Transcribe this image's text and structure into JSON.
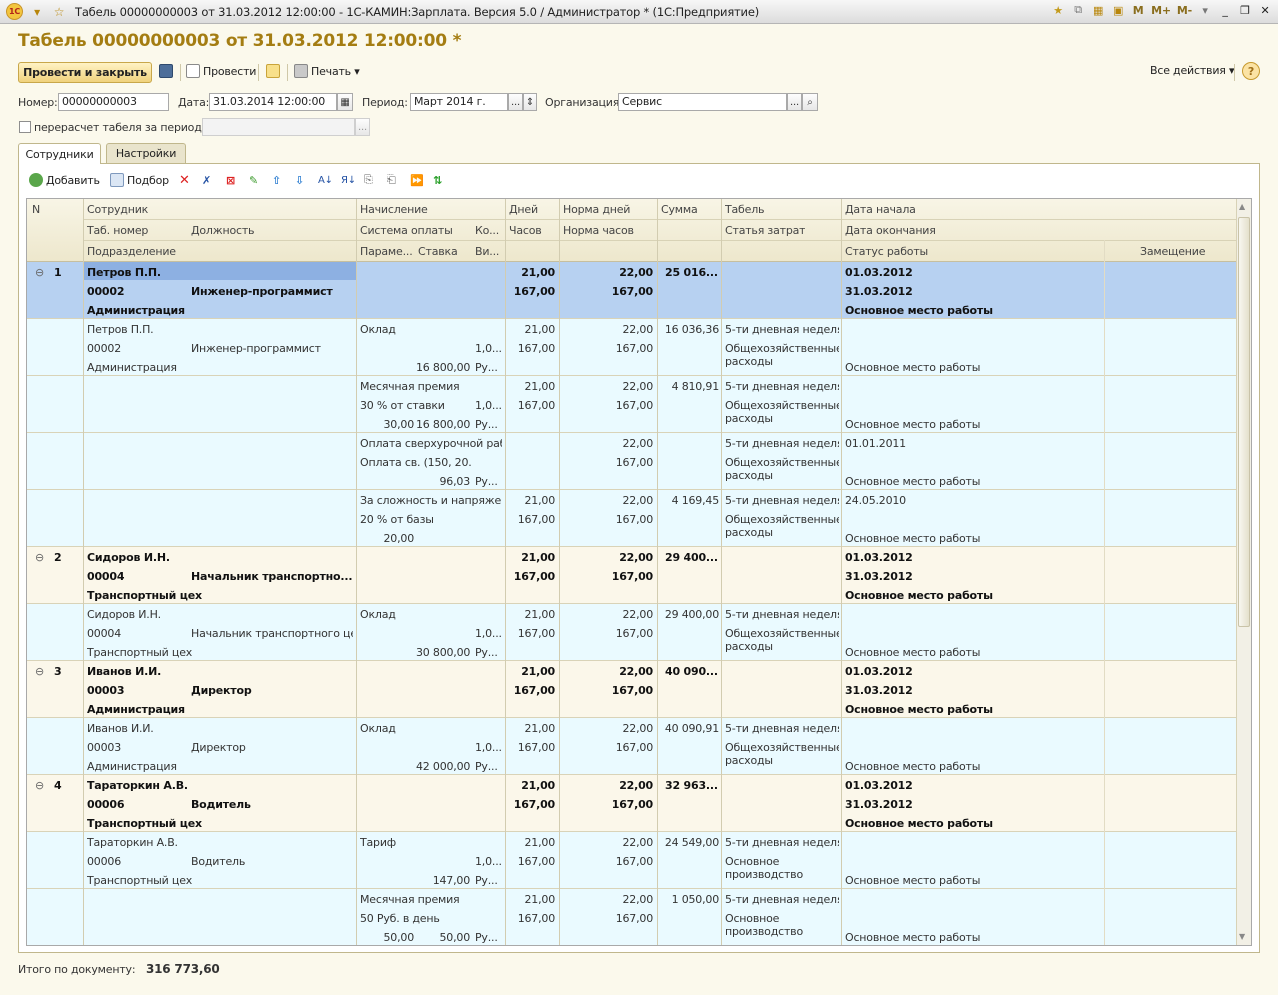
{
  "window": {
    "title": "Табель 00000000003 от 31.03.2012 12:00:00 - 1С-КАМИН:Зарплата. Версия 5.0 / Администратор * (1С:Предприятие)",
    "logo": "1С",
    "controls": [
      "M",
      "M+",
      "M-"
    ]
  },
  "heading": "Табель 00000000003 от 31.03.2012 12:00:00 *",
  "toolbar": {
    "post_close": "Провести и закрыть",
    "post": "Провести",
    "print": "Печать ▾",
    "all_actions": "Все действия ▾",
    "help": "?"
  },
  "form": {
    "number_label": "Номер:",
    "number_value": "00000000003",
    "date_label": "Дата:",
    "date_value": "31.03.2014 12:00:00",
    "period_label": "Период:",
    "period_value": "Март 2014 г.",
    "org_label": "Организация:",
    "org_value": "Сервис",
    "recalc_label": "перерасчет табеля за период",
    "dots": "..."
  },
  "tabs": [
    "Сотрудники",
    "Настройки"
  ],
  "grid_toolbar": {
    "add": "Добавить",
    "select": "Подбор"
  },
  "columns": {
    "n": "N",
    "r1": [
      "Сотрудник",
      "Начисление",
      "Дней",
      "Норма дней",
      "Сумма",
      "Табель",
      "Дата начала"
    ],
    "r2": [
      "Таб. номер",
      "Должность",
      "Система оплаты",
      "Ко...",
      "Часов",
      "Норма часов",
      "Статья затрат",
      "Дата окончания"
    ],
    "r3": [
      "Подразделение",
      "Параме...",
      "Ставка",
      "Ви...",
      "Статус работы",
      "Замещение"
    ]
  },
  "rows": [
    {
      "type": "group",
      "n": "1",
      "expander": "⊖",
      "name": "Петров П.П.",
      "tab": "00002",
      "pos": "Инженер-программист",
      "dep": "Администрация",
      "days": "21,00",
      "norm_days": "22,00",
      "sum": "25 016...",
      "hours": "167,00",
      "norm_hours": "167,00",
      "start": "01.03.2012",
      "end": "31.03.2012",
      "status": "Основное место работы"
    },
    {
      "type": "detail",
      "l1": [
        "Петров П.П.",
        "",
        "Оклад",
        "21,00",
        "22,00",
        "16 036,36",
        "5-ти дневная неделя",
        ""
      ],
      "l2": [
        "00002",
        "Инженер-программист",
        "",
        "",
        "1,0...",
        "167,00",
        "167,00",
        "Общехозяйственные расходы",
        ""
      ],
      "l3": [
        "Администрация",
        "",
        "16 800,00",
        "Ру...",
        "Основное место работы"
      ]
    },
    {
      "type": "detail",
      "l1": [
        "",
        "",
        "Месячная премия",
        "21,00",
        "22,00",
        "4 810,91",
        "5-ти дневная неделя",
        ""
      ],
      "l2": [
        "",
        "",
        "30 % от ставки",
        "",
        "1,0...",
        "167,00",
        "167,00",
        "Общехозяйственные расходы",
        ""
      ],
      "l3": [
        "",
        "30,00",
        "16 800,00",
        "Ру...",
        "Основное место работы"
      ]
    },
    {
      "type": "detail",
      "l1": [
        "",
        "",
        "Оплата сверхурочной раб...",
        "",
        "22,00",
        "",
        "5-ти дневная неделя",
        "01.01.2011"
      ],
      "l2": [
        "",
        "",
        "Оплата св. (150, 20...",
        "",
        "",
        "",
        "167,00",
        "Общехозяйственные расходы",
        ""
      ],
      "l3": [
        "",
        "",
        "96,03",
        "Ру...",
        "Основное место работы"
      ]
    },
    {
      "type": "detail",
      "l1": [
        "",
        "",
        "За сложность и напряже...",
        "21,00",
        "22,00",
        "4 169,45",
        "5-ти дневная неделя",
        "24.05.2010"
      ],
      "l2": [
        "",
        "",
        "20 % от базы",
        "",
        "",
        "167,00",
        "167,00",
        "Общехозяйственные расходы",
        ""
      ],
      "l3": [
        "",
        "20,00",
        "",
        "",
        "Основное место работы"
      ]
    },
    {
      "type": "group",
      "n": "2",
      "expander": "⊖",
      "name": "Сидоров И.Н.",
      "tab": "00004",
      "pos": "Начальник транспортно...",
      "dep": "Транспортный цех",
      "days": "21,00",
      "norm_days": "22,00",
      "sum": "29 400...",
      "hours": "167,00",
      "norm_hours": "167,00",
      "start": "01.03.2012",
      "end": "31.03.2012",
      "status": "Основное место работы"
    },
    {
      "type": "detail",
      "l1": [
        "Сидоров И.Н.",
        "",
        "Оклад",
        "21,00",
        "22,00",
        "29 400,00",
        "5-ти дневная неделя",
        ""
      ],
      "l2": [
        "00004",
        "Начальник транспортного цеха",
        "",
        "",
        "1,0...",
        "167,00",
        "167,00",
        "Общехозяйственные расходы",
        ""
      ],
      "l3": [
        "Транспортный цех",
        "",
        "30 800,00",
        "Ру...",
        "Основное место работы"
      ]
    },
    {
      "type": "group",
      "n": "3",
      "expander": "⊖",
      "name": "Иванов И.И.",
      "tab": "00003",
      "pos": "Директор",
      "dep": "Администрация",
      "days": "21,00",
      "norm_days": "22,00",
      "sum": "40 090...",
      "hours": "167,00",
      "norm_hours": "167,00",
      "start": "01.03.2012",
      "end": "31.03.2012",
      "status": "Основное место работы"
    },
    {
      "type": "detail",
      "l1": [
        "Иванов И.И.",
        "",
        "Оклад",
        "21,00",
        "22,00",
        "40 090,91",
        "5-ти дневная неделя",
        ""
      ],
      "l2": [
        "00003",
        "Директор",
        "",
        "",
        "1,0...",
        "167,00",
        "167,00",
        "Общехозяйственные расходы",
        ""
      ],
      "l3": [
        "Администрация",
        "",
        "42 000,00",
        "Ру...",
        "Основное место работы"
      ]
    },
    {
      "type": "group",
      "n": "4",
      "expander": "⊖",
      "name": "Тараторкин А.В.",
      "tab": "00006",
      "pos": "Водитель",
      "dep": "Транспортный цех",
      "days": "21,00",
      "norm_days": "22,00",
      "sum": "32 963...",
      "hours": "167,00",
      "norm_hours": "167,00",
      "start": "01.03.2012",
      "end": "31.03.2012",
      "status": "Основное место работы"
    },
    {
      "type": "detail",
      "l1": [
        "Тараторкин А.В.",
        "",
        "Тариф",
        "21,00",
        "22,00",
        "24 549,00",
        "5-ти дневная неделя",
        ""
      ],
      "l2": [
        "00006",
        "Водитель",
        "",
        "",
        "1,0...",
        "167,00",
        "167,00",
        "Основное производство",
        ""
      ],
      "l3": [
        "Транспортный цех",
        "",
        "147,00",
        "Ру...",
        "Основное место работы"
      ]
    },
    {
      "type": "detail",
      "l1": [
        "",
        "",
        "Месячная премия",
        "21,00",
        "22,00",
        "1 050,00",
        "5-ти дневная неделя",
        ""
      ],
      "l2": [
        "",
        "",
        "50 Руб. в день",
        "",
        "",
        "167,00",
        "167,00",
        "Основное производство",
        ""
      ],
      "l3": [
        "",
        "50,00",
        "50,00",
        "Ру...",
        "Основное место работы"
      ]
    }
  ],
  "total": {
    "label": "Итого по документу:",
    "value": "316 773,60"
  },
  "colors": {
    "heading": "#a47d12",
    "selected_row": "#b7d1f1",
    "detail_row": "#eafaff",
    "group_row": "#fbf7ea"
  }
}
